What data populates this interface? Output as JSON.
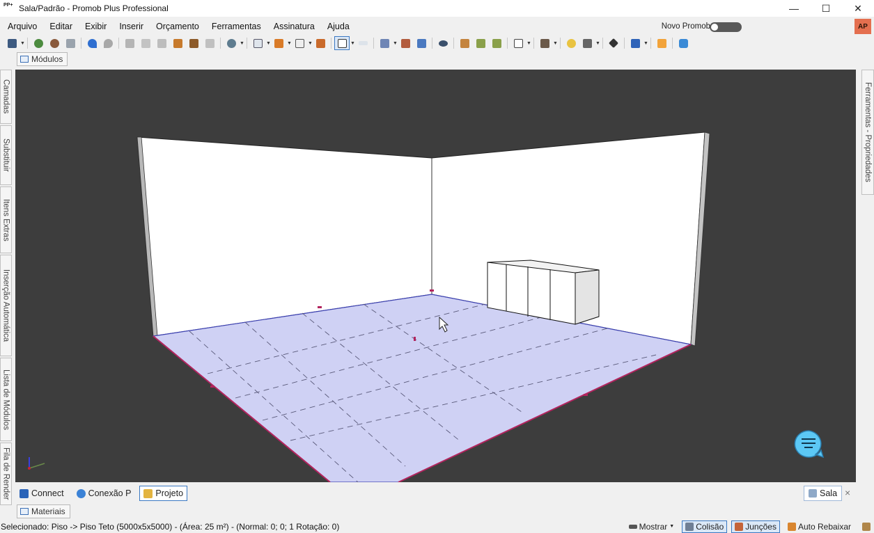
{
  "window": {
    "app_icon_text": "PP+",
    "title": "Sala/Padrão - Promob Plus Professional",
    "minimize": "—",
    "maximize": "☐",
    "close": "✕"
  },
  "menu": {
    "items": [
      "Arquivo",
      "Editar",
      "Exibir",
      "Inserir",
      "Orçamento",
      "Ferramentas",
      "Assinatura",
      "Ajuda"
    ],
    "novo_promob": "Novo Promob",
    "avatar": "AP"
  },
  "tabs": {
    "modulos": "Módulos",
    "materiais": "Materiais",
    "sala": "Sala",
    "close": "×"
  },
  "left_panels": [
    "Camadas",
    "Substituir",
    "Itens Extras",
    "Inserção Automática",
    "Lista de Módulos",
    "Fila de Render"
  ],
  "right_panel": "Ferramentas - Propriedades",
  "bottom_tabs": [
    {
      "label": "Connect",
      "icon": "rss-icon",
      "color": "#2a63b8"
    },
    {
      "label": "Conexão P",
      "icon": "globe-icon",
      "color": "#3b82d6"
    },
    {
      "label": "Projeto",
      "icon": "folder-icon",
      "color": "#e3b440"
    }
  ],
  "status": {
    "text": "Selecionado: Piso -> Piso Teto (5000x5x5000) - (Área: 25 m²) - (Normal: 0; 0; 1 Rotação: 0)",
    "mostrar": "Mostrar",
    "colisao": "Colisão",
    "juncoes": "Junções",
    "auto_rebaixar": "Auto Rebaixar"
  },
  "colors": {
    "viewport_bg": "#3d3d3d",
    "floor": "#cfd1f4",
    "accent": "#3a78c2",
    "chat": "#5cc8f5"
  }
}
